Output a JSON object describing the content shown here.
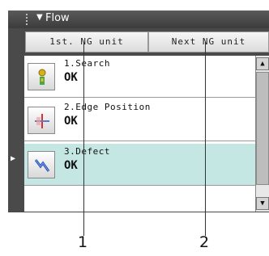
{
  "flow": {
    "title": "Flow",
    "collapse_arrow": "▼"
  },
  "toolbar": {
    "first_ng_label": "1st. NG unit",
    "next_ng_label": "Next NG unit"
  },
  "units": [
    {
      "name": "1.Search",
      "status": "OK",
      "icon": "search-unit-icon"
    },
    {
      "name": "2.Edge Position",
      "status": "OK",
      "icon": "edge-position-icon"
    },
    {
      "name": "3.Defect",
      "status": "OK",
      "icon": "defect-icon",
      "selected": true
    }
  ],
  "current_marker": "▶",
  "scrollbar": {
    "up": "▲",
    "down": "▼"
  },
  "callouts": [
    "1",
    "2"
  ]
}
